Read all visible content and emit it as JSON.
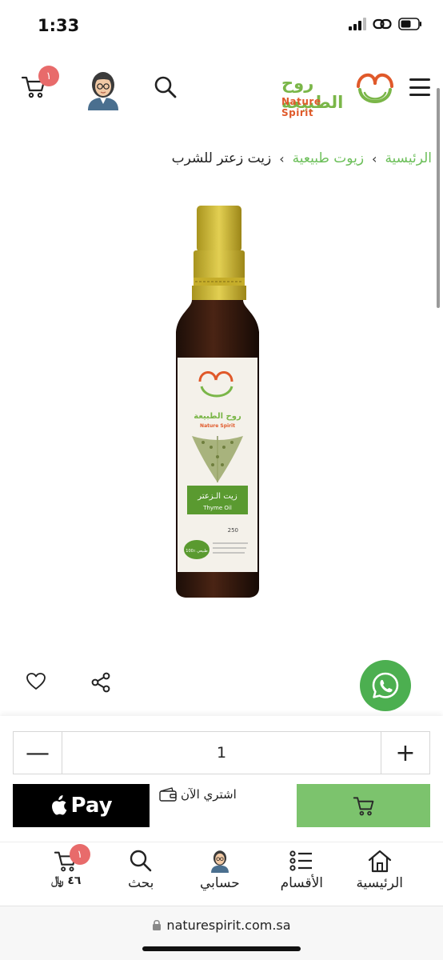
{
  "status_bar": {
    "time": "1:33"
  },
  "header": {
    "logo_ar": "روح الطبيعة",
    "logo_en": "Nature Spirit",
    "cart_count": "١"
  },
  "breadcrumb": {
    "home": "الرئيسية",
    "category": "زيوت طبيعية",
    "current": "زيت زعتر للشرب"
  },
  "product": {
    "label_brand_ar": "روح الطبيعة",
    "label_brand_en": "Nature Spirit",
    "label_name_ar": "زيت الـزعتر",
    "label_name_en": "Thyme Oil",
    "label_size": "250",
    "label_badge": "100٪ طبيعي"
  },
  "quantity": {
    "value": "1",
    "minus": "—",
    "plus": "+"
  },
  "actions": {
    "apple_pay_label": "Pay",
    "buy_now_label": "اشتري الآن"
  },
  "bottom_nav": {
    "home": "الرئيسية",
    "categories": "الأقسام",
    "account": "حسابي",
    "search": "بحث",
    "cart_count": "١",
    "cart_total": "٤٦ ﷼"
  },
  "url_bar": {
    "domain": "naturespirit.com.sa"
  },
  "colors": {
    "brand_green": "#6cbf5a",
    "add_to_cart_green": "#7cc36d",
    "badge_red": "#e86b6b",
    "whatsapp_green": "#4caf50"
  }
}
